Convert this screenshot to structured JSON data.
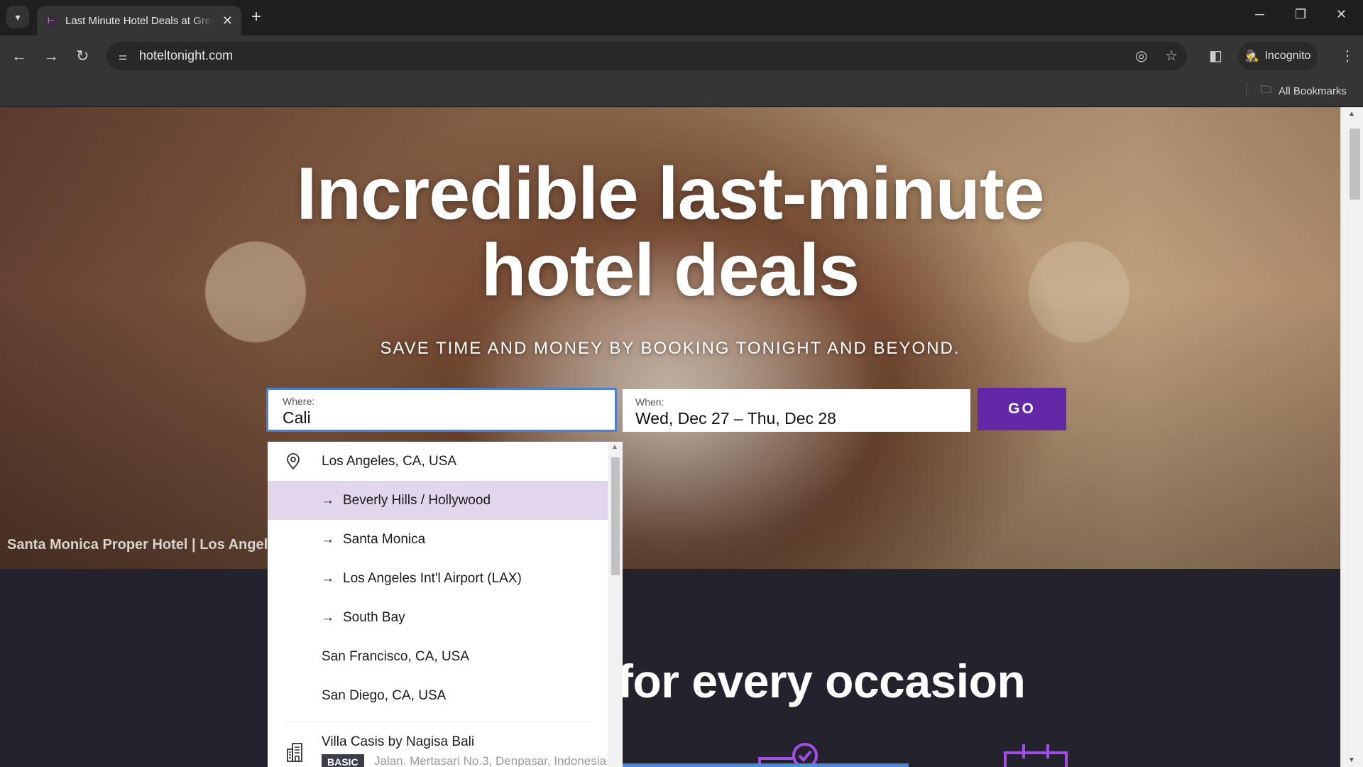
{
  "browser": {
    "tab_title": "Last Minute Hotel Deals at Great Prices",
    "url": "hoteltonight.com",
    "profile_label": "Incognito",
    "bookmarks_label": "All Bookmarks",
    "icons": {
      "tab_search": "▾",
      "favicon": "⊢",
      "tab_close": "✕",
      "new_tab": "+",
      "minimize": "─",
      "maximize": "❐",
      "close": "✕",
      "back": "←",
      "forward": "→",
      "reload": "↻",
      "site_info": "⚌",
      "eye_off": "◎",
      "star": "☆",
      "side_panel": "◧",
      "incognito": "🕵",
      "menu": "⋮",
      "folder": "🗀"
    }
  },
  "hero": {
    "title_line1": "Incredible last-minute",
    "title_line2": "hotel deals",
    "subtitle": "SAVE TIME AND MONEY BY BOOKING TONIGHT AND BEYOND.",
    "caption": "Santa Monica Proper Hotel | Los Angeles"
  },
  "search": {
    "where_label": "Where:",
    "where_value": "Cali",
    "when_label": "When:",
    "when_value": "Wed, Dec 27 – Thu, Dec 28",
    "go_label": "GO"
  },
  "suggestions": {
    "items": [
      {
        "label": "Los Angeles, CA, USA",
        "type": "city",
        "icon": "location-pin"
      },
      {
        "label": "Beverly Hills / Hollywood",
        "type": "neighborhood",
        "icon": "arrow-right",
        "hovered": true
      },
      {
        "label": "Santa Monica",
        "type": "neighborhood",
        "icon": "arrow-right"
      },
      {
        "label": "Los Angeles Int'l Airport (LAX)",
        "type": "neighborhood",
        "icon": "arrow-right"
      },
      {
        "label": "South Bay",
        "type": "neighborhood",
        "icon": "arrow-right"
      },
      {
        "label": "San Francisco, CA, USA",
        "type": "city"
      },
      {
        "label": "San Diego, CA, USA",
        "type": "city"
      }
    ],
    "hotel": {
      "name": "Villa Casis by Nagisa Bali",
      "badge": "BASIC",
      "address": "Jalan. Mertasari No.3, Denpasar, Indonesia"
    }
  },
  "section": {
    "title": "for every occasion"
  },
  "colors": {
    "brand_purple": "#6228a8",
    "hover_row": "#e2d6ec",
    "focus_border": "#4a7ed8",
    "page_dark": "#24222c",
    "icon_purple": "#a24ee6"
  }
}
